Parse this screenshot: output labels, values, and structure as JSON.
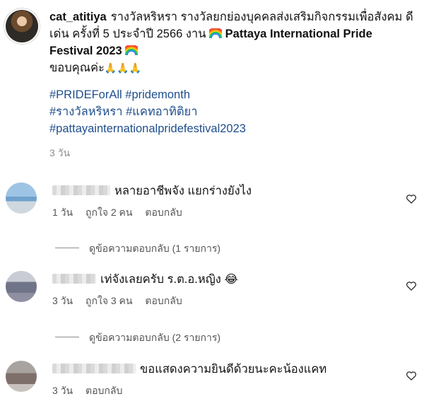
{
  "caption": {
    "username": "cat_atitiya",
    "text_part1": "รางวัลหริหรา รางวัลยกย่องบุคคลส่งเสริมกิจกรรมเพื่อสังคม ดีเด่น ครั้งที่ 5 ประจำปี 2566 งาน ",
    "bold_text": "Pattaya International Pride Festival 2023",
    "thanks": "ขอบคุณค่ะ",
    "pray_emoji": "🙏🙏🙏",
    "tags_line1": "#PRIDEForAll #pridemonth",
    "tags_line2": "#รางวัลหริหรา #แคทอาทิติยา",
    "tags_line3": "#pattayainternationalpridefestival2023",
    "time": "3 วัน"
  },
  "comments": [
    {
      "text": "หลายอาชีพจัง แยกร่างยังไง",
      "time": "1 วัน",
      "likes": "ถูกใจ 2 คน",
      "reply": "ตอบกลับ",
      "view_replies": "ดูข้อความตอบกลับ (1 รายการ)",
      "emoji": ""
    },
    {
      "text": "เท่จังเลยครับ ร.ต.อ.หญิง",
      "time": "3 วัน",
      "likes": "ถูกใจ 3 คน",
      "reply": "ตอบกลับ",
      "view_replies": "ดูข้อความตอบกลับ (2 รายการ)",
      "emoji": "😂"
    },
    {
      "text": "ขอแสดงความยินดีด้วยนะคะน้องแคท",
      "time": "3 วัน",
      "likes": "",
      "reply": "ตอบกลับ",
      "view_replies": "",
      "emoji": ""
    }
  ],
  "icons": {
    "like": "heart-icon",
    "rainbow": "rainbow-flag-icon"
  }
}
